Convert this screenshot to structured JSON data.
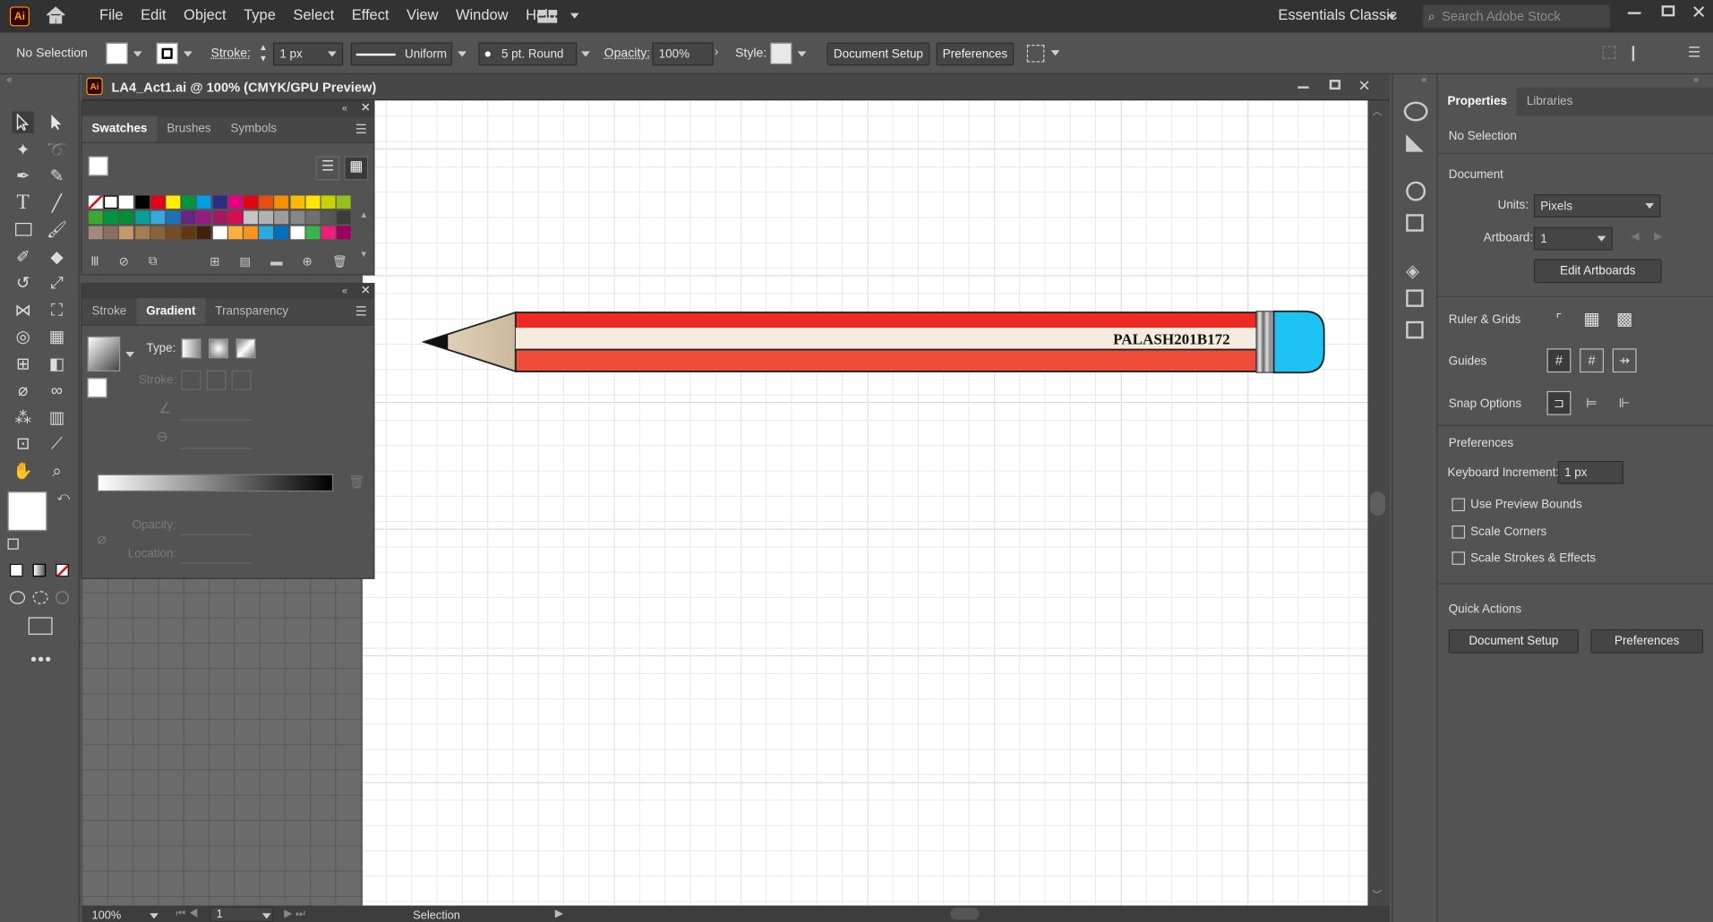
{
  "app": {
    "logo": "Ai",
    "menu": [
      "File",
      "Edit",
      "Object",
      "Type",
      "Select",
      "Effect",
      "View",
      "Window",
      "Help"
    ],
    "workspace": "Essentials Classic",
    "search_placeholder": "Search Adobe Stock"
  },
  "control": {
    "selection": "No Selection",
    "stroke_label": "Stroke:",
    "stroke_value": "1 px",
    "profile": "Uniform",
    "brush": "5 pt. Round",
    "opacity_label": "Opacity:",
    "opacity_value": "100%",
    "style_label": "Style:",
    "doc_setup": "Document Setup",
    "preferences": "Preferences"
  },
  "document": {
    "tab_title": "LA4_Act1.ai @ 100% (CMYK/GPU Preview)"
  },
  "swatches_panel": {
    "tabs": [
      "Swatches",
      "Brushes",
      "Symbols"
    ]
  },
  "gradient_panel": {
    "tabs": [
      "Stroke",
      "Gradient",
      "Transparency"
    ],
    "type_label": "Type:",
    "stroke_label": "Stroke:",
    "opacity_label": "Opacity:",
    "location_label": "Location:"
  },
  "artwork": {
    "pencil_text": "PALASH201B172",
    "colors": {
      "body_red": "#ee2a24",
      "stripe": "#f5ecdf",
      "lower_red": "#ef4d3a",
      "eraser": "#1cc2f2",
      "wood": "#d8c8b0",
      "lead": "#111111"
    }
  },
  "properties": {
    "tabs": [
      "Properties",
      "Libraries"
    ],
    "selection": "No Selection",
    "document": "Document",
    "units_label": "Units:",
    "units_value": "Pixels",
    "artboard_label": "Artboard:",
    "artboard_value": "1",
    "edit_artboards": "Edit Artboards",
    "ruler_grids": "Ruler & Grids",
    "guides": "Guides",
    "snap_options": "Snap Options",
    "preferences": "Preferences",
    "keyboard_increment_label": "Keyboard Increment:",
    "keyboard_increment_value": "1 px",
    "checkboxes": [
      "Use Preview Bounds",
      "Scale Corners",
      "Scale Strokes & Effects"
    ],
    "quick_actions": "Quick Actions",
    "doc_setup": "Document Setup",
    "prefs_button": "Preferences"
  },
  "status": {
    "zoom": "100%",
    "artboard": "1",
    "tool": "Selection"
  }
}
